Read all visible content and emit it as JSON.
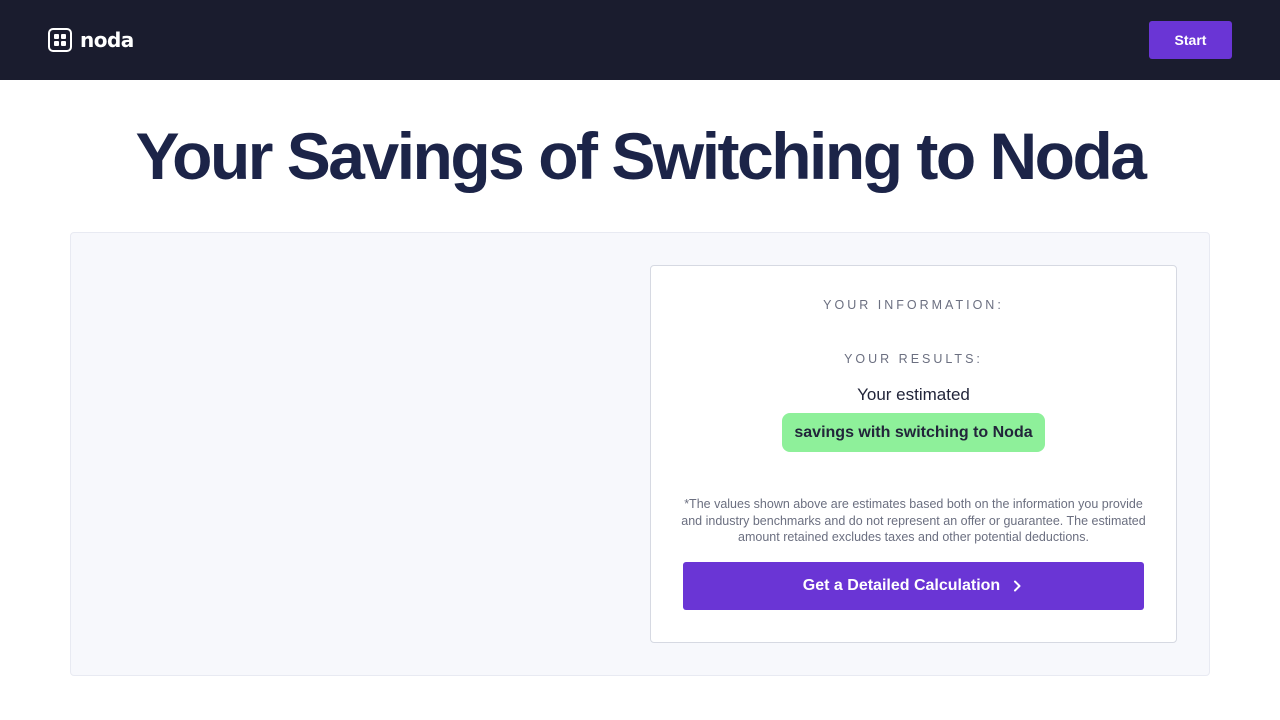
{
  "header": {
    "logo_text": "noda",
    "start_label": "Start"
  },
  "main": {
    "title": "Your Savings of Switching to Noda"
  },
  "results_card": {
    "info_label": "YOUR INFORMATION:",
    "results_label": "YOUR RESULTS:",
    "estimated_text": "Your estimated",
    "savings_pill": "savings with switching to Noda",
    "disclaimer": "*The values shown above are estimates based both on the information you provide and industry benchmarks and do not represent an offer or guarantee. The estimated amount retained excludes taxes and other potential deductions.",
    "cta_label": "Get a Detailed Calculation"
  },
  "colors": {
    "header_bg": "#1a1c2e",
    "accent": "#6a35d5",
    "title_color": "#1c2448",
    "pill_bg": "#8ef09a",
    "panel_bg": "#f7f8fc"
  },
  "icons": {
    "logo": "noda-logo-icon",
    "cta_arrow": "chevron-right-icon"
  }
}
